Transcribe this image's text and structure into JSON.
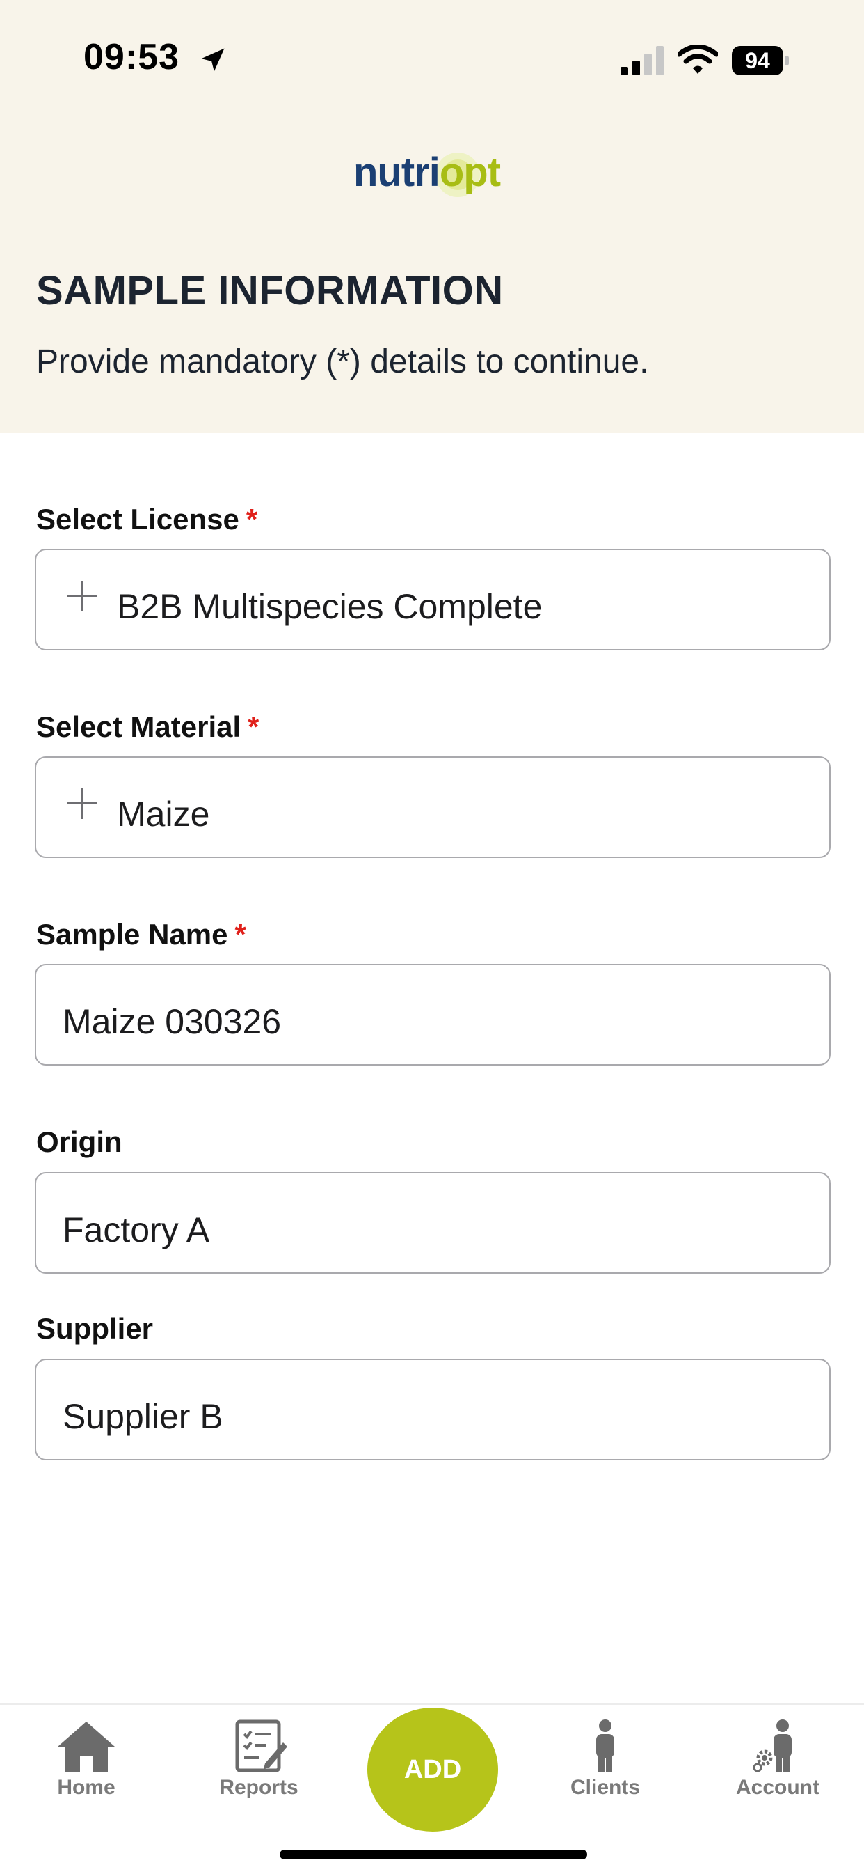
{
  "status_bar": {
    "time": "09:53",
    "battery": "94",
    "icons": [
      "location-arrow-icon",
      "cellular-signal-icon",
      "wifi-icon",
      "battery-icon"
    ]
  },
  "logo": {
    "text_main": "nutri",
    "text_accent": "opt",
    "brand_color": "#1b3f73",
    "accent_color": "#a8bd14"
  },
  "header": {
    "title": "SAMPLE INFORMATION",
    "subtitle": "Provide mandatory (*) details to continue."
  },
  "form": {
    "required_marker": "*",
    "license": {
      "label": "Select License",
      "value": "B2B Multispecies Complete",
      "icon": "plus-icon"
    },
    "material": {
      "label": "Select Material",
      "value": "Maize",
      "icon": "plus-icon"
    },
    "sample_name": {
      "label": "Sample Name",
      "value": "Maize 030326"
    },
    "origin": {
      "label": "Origin",
      "value": "Factory A"
    },
    "supplier": {
      "label": "Supplier",
      "value": "Supplier B"
    }
  },
  "tabbar": {
    "home": "Home",
    "reports": "Reports",
    "add": "ADD",
    "clients": "Clients",
    "account": "Account",
    "add_color": "#b6c41a"
  },
  "colors": {
    "header_bg": "#f8f4ea",
    "required": "#e0201a"
  }
}
